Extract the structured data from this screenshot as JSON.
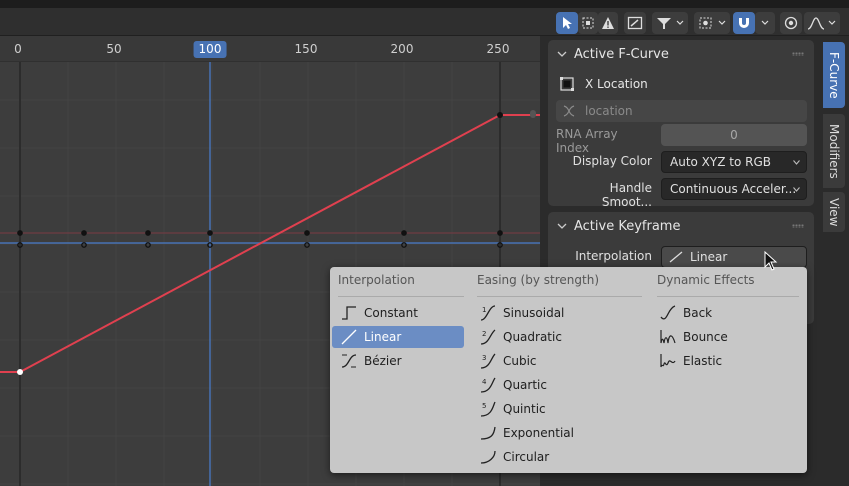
{
  "header": {
    "tools": [
      {
        "icon": "select-cursor-icon"
      },
      {
        "icon": "box-select-icon"
      },
      {
        "icon": "warning-icon"
      },
      {
        "icon": "screenshot-icon"
      },
      {
        "icon": "filter-icon"
      },
      {
        "icon": "pivot-icon"
      },
      {
        "icon": "snap-magnet-icon"
      },
      {
        "icon": "proportional-icon"
      },
      {
        "icon": "falloff-icon"
      }
    ]
  },
  "ruler": {
    "labels": [
      "0",
      "50",
      "100",
      "150",
      "200",
      "250"
    ],
    "current_frame": "100"
  },
  "sidebar": {
    "active_fcurve": {
      "title": "Active F-Curve",
      "channel_name": "X Location",
      "data_path_placeholder": "location",
      "rna_array_index_label": "RNA Array Index",
      "rna_array_index_value": "0",
      "display_color_label": "Display Color",
      "display_color_value": "Auto XYZ to RGB",
      "handle_smoothing_label": "Handle Smoot...",
      "handle_smoothing_value": "Continuous Acceler..."
    },
    "active_keyframe": {
      "title": "Active Keyframe",
      "interpolation_label": "Interpolation",
      "interpolation_value": "Linear"
    }
  },
  "tabs": [
    {
      "label": "F-Curve",
      "active": true
    },
    {
      "label": "Modifiers",
      "active": false
    },
    {
      "label": "View",
      "active": false
    }
  ],
  "menu": {
    "columns": [
      {
        "title": "Interpolation",
        "items": [
          {
            "label": "Constant",
            "icon": "ipo-constant-icon"
          },
          {
            "label": "Linear",
            "icon": "ipo-linear-icon",
            "selected": true
          },
          {
            "label": "Bézier",
            "icon": "ipo-bezier-icon"
          }
        ]
      },
      {
        "title": "Easing (by strength)",
        "items": [
          {
            "label": "Sinusoidal",
            "icon": "ipo-sine-icon"
          },
          {
            "label": "Quadratic",
            "icon": "ipo-quad-icon"
          },
          {
            "label": "Cubic",
            "icon": "ipo-cubic-icon"
          },
          {
            "label": "Quartic",
            "icon": "ipo-quart-icon"
          },
          {
            "label": "Quintic",
            "icon": "ipo-quint-icon"
          },
          {
            "label": "Exponential",
            "icon": "ipo-expo-icon"
          },
          {
            "label": "Circular",
            "icon": "ipo-circ-icon"
          }
        ]
      },
      {
        "title": "Dynamic Effects",
        "items": [
          {
            "label": "Back",
            "icon": "ipo-back-icon"
          },
          {
            "label": "Bounce",
            "icon": "ipo-bounce-icon"
          },
          {
            "label": "Elastic",
            "icon": "ipo-elastic-icon"
          }
        ]
      }
    ]
  },
  "colors": {
    "curve": "#e0404f",
    "current_frame": "#4772b3",
    "menu_selected": "#6b8dc4"
  }
}
